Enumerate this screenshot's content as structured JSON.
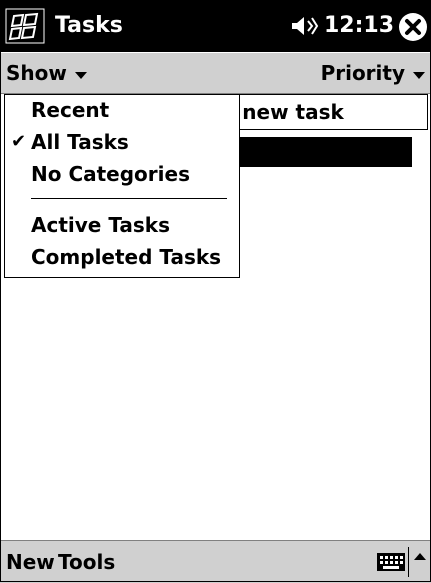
{
  "titlebar": {
    "app_title": "Tasks",
    "clock": "12:13",
    "icons": [
      "windows-start-icon",
      "speaker-icon",
      "close-icon"
    ]
  },
  "menubar": {
    "show_label": "Show",
    "priority_label": "Priority"
  },
  "content": {
    "new_task_text": "l a new task"
  },
  "show_menu": {
    "items": [
      {
        "label": "Recent",
        "checked": false
      },
      {
        "label": "All Tasks",
        "checked": true
      },
      {
        "label": "No Categories",
        "checked": false
      },
      {
        "label": "Active Tasks",
        "checked": false
      },
      {
        "label": "Completed Tasks",
        "checked": false
      }
    ],
    "check_glyph": "✔"
  },
  "bottombar": {
    "new_label": "New",
    "tools_label": "Tools",
    "icons": [
      "keyboard-icon",
      "sip-up-arrow-icon"
    ]
  }
}
